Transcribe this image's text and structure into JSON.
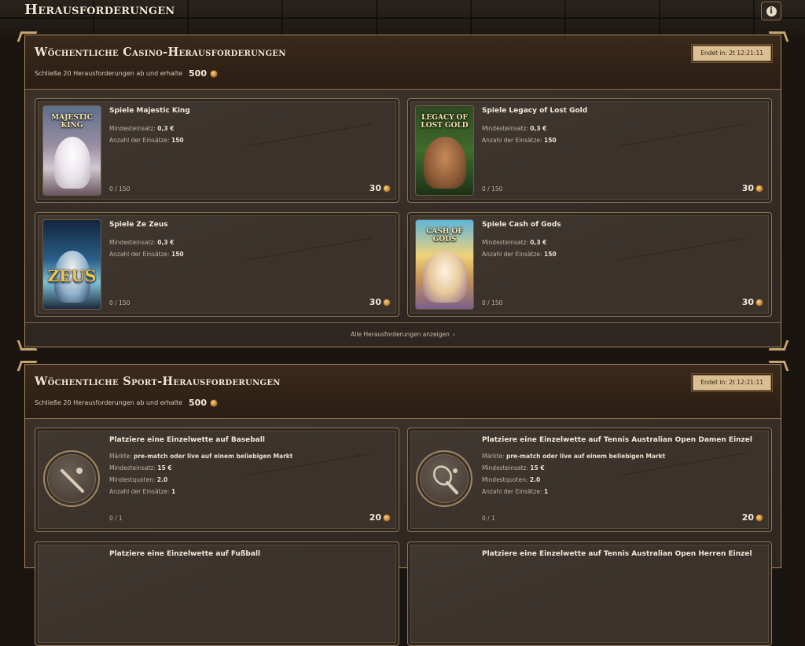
{
  "page": {
    "title": "Herausforderungen"
  },
  "colors": {
    "accent": "#a8865a",
    "badge": "#d9bf93",
    "coin": "#c8893a"
  },
  "casino": {
    "title": "Wöchentliche Casino-Herausforderungen",
    "subtitle": "Schließe 20 Herausforderungen ab und erhalte",
    "reward": "500",
    "ends": "Endet in: 2t 12:21:11",
    "show_all": "Alle Herausforderungen anzeigen",
    "cards": [
      {
        "title": "Spiele Majestic King",
        "thumb_text": "MAJESTIC KING",
        "min_label": "Mindesteinsatz:",
        "min_value": "0,3 €",
        "count_label": "Anzahl der Einsätze:",
        "count_value": "150",
        "progress": "0 / 150",
        "reward": "30"
      },
      {
        "title": "Spiele Legacy of Lost Gold",
        "thumb_text": "LEGACY OF LOST GOLD",
        "min_label": "Mindesteinsatz:",
        "min_value": "0,3 €",
        "count_label": "Anzahl der Einsätze:",
        "count_value": "150",
        "progress": "0 / 150",
        "reward": "30"
      },
      {
        "title": "Spiele Ze Zeus",
        "thumb_text": "ZEUS",
        "min_label": "Mindesteinsatz:",
        "min_value": "0,3 €",
        "count_label": "Anzahl der Einsätze:",
        "count_value": "150",
        "progress": "0 / 150",
        "reward": "30"
      },
      {
        "title": "Spiele Cash of Gods",
        "thumb_text": "CASH OF GODS",
        "min_label": "Mindesteinsatz:",
        "min_value": "0,3 €",
        "count_label": "Anzahl der Einsätze:",
        "count_value": "150",
        "progress": "0 / 150",
        "reward": "30"
      }
    ]
  },
  "sport": {
    "title": "Wöchentliche Sport-Herausforderungen",
    "subtitle": "Schließe 20 Herausforderungen ab und erhalte",
    "reward": "500",
    "ends": "Endet in: 2t 12:21:11",
    "cards": [
      {
        "title": "Platziere eine Einzelwette auf Baseball",
        "icon": "baseball-icon",
        "markets_label": "Märkte:",
        "markets_value": "pre-match oder live auf einem beliebigen Markt",
        "min_label": "Mindesteinsatz:",
        "min_value": "15 €",
        "odds_label": "Mindestquoten:",
        "odds_value": "2.0",
        "count_label": "Anzahl der Einsätze:",
        "count_value": "1",
        "progress": "0 / 1",
        "reward": "20"
      },
      {
        "title": "Platziere eine Einzelwette auf Tennis Australian Open Damen Einzel",
        "icon": "tennis-icon",
        "markets_label": "Märkte:",
        "markets_value": "pre-match oder live auf einem beliebigen Markt",
        "min_label": "Mindesteinsatz:",
        "min_value": "15 €",
        "odds_label": "Mindestquoten:",
        "odds_value": "2.0",
        "count_label": "Anzahl der Einsätze:",
        "count_value": "1",
        "progress": "0 / 1",
        "reward": "20"
      },
      {
        "title": "Platziere eine Einzelwette auf Fußball"
      },
      {
        "title": "Platziere eine Einzelwette auf Tennis Australian Open Herren Einzel"
      }
    ]
  }
}
